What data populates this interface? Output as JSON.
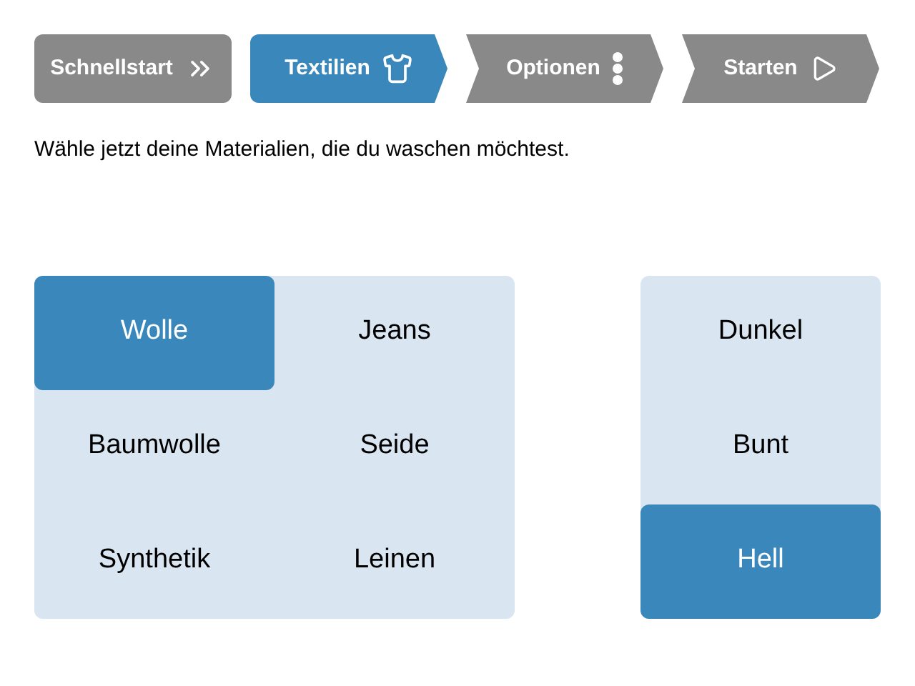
{
  "steps": [
    {
      "label": "Schnellstart",
      "kind": "first",
      "selected": false
    },
    {
      "label": "Textilien",
      "kind": "arrow",
      "selected": true
    },
    {
      "label": "Optionen",
      "kind": "notched",
      "selected": false
    },
    {
      "label": "Starten",
      "kind": "notched",
      "selected": false
    }
  ],
  "instruction": "Wähle jetzt deine Materialien, die du waschen möchtest.",
  "materials": [
    {
      "label": "Wolle",
      "selected": true
    },
    {
      "label": "Jeans",
      "selected": false
    },
    {
      "label": "Baumwolle",
      "selected": false
    },
    {
      "label": "Seide",
      "selected": false
    },
    {
      "label": "Synthetik",
      "selected": false
    },
    {
      "label": "Leinen",
      "selected": false
    }
  ],
  "colors": [
    {
      "label": "Dunkel",
      "selected": false
    },
    {
      "label": "Bunt",
      "selected": false
    },
    {
      "label": "Hell",
      "selected": true
    }
  ]
}
